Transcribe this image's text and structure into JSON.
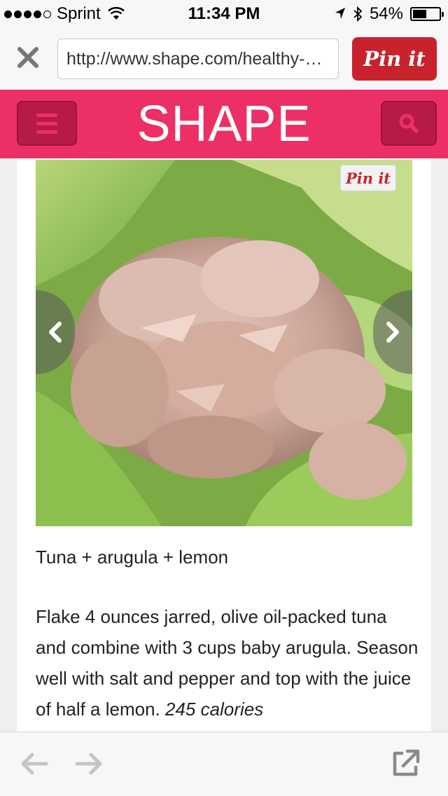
{
  "status_bar": {
    "carrier": "Sprint",
    "time": "11:34 PM",
    "battery": "54%",
    "battery_level": 0.54,
    "signal_bars": 4
  },
  "address_bar": {
    "url": "http://www.shape.com/healthy-…",
    "pin_label": "Pin it",
    "close_icon": "close-icon"
  },
  "header": {
    "logo": "SHAPE",
    "menu_icon": "hamburger-menu-icon",
    "search_icon": "search-icon",
    "brand_color": "#ec3066"
  },
  "article": {
    "photo_pin_label": "Pin it",
    "caption": "Tuna + arugula + lemon",
    "description": "Flake 4 ounces jarred, olive oil-packed tuna and combine with 3 cups baby arugula. Season well with salt and pepper and top with the juice of half a lemon.",
    "calories": "245 calories"
  },
  "toolbar": {
    "back_icon": "back-arrow-icon",
    "forward_icon": "forward-arrow-icon",
    "share_icon": "open-external-icon"
  }
}
